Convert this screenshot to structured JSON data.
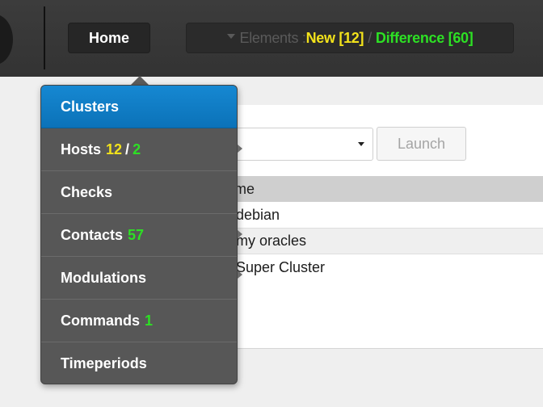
{
  "header": {
    "home_label": "Home",
    "elements": {
      "prefix": "Elements : ",
      "new_label": "New [12]",
      "separator": "/",
      "difference_label": "Difference [60]"
    }
  },
  "main": {
    "launch_label": "Launch",
    "table": {
      "column_header": "me",
      "rows": [
        "debian",
        "my oracles",
        "Super Cluster"
      ]
    }
  },
  "menu": {
    "items": [
      {
        "label": "Clusters"
      },
      {
        "label": "Hosts",
        "count_a": "12",
        "count_sep": "/",
        "count_b": "2"
      },
      {
        "label": "Checks"
      },
      {
        "label": "Contacts",
        "count": "57"
      },
      {
        "label": "Modulations"
      },
      {
        "label": "Commands",
        "count": "1"
      },
      {
        "label": "Timeperiods"
      }
    ]
  },
  "colors": {
    "active_menu": "#1688d2",
    "new_count": "#f2e21b",
    "difference_count": "#2de024",
    "menu_background": "#575757",
    "topbar": "#383838"
  }
}
